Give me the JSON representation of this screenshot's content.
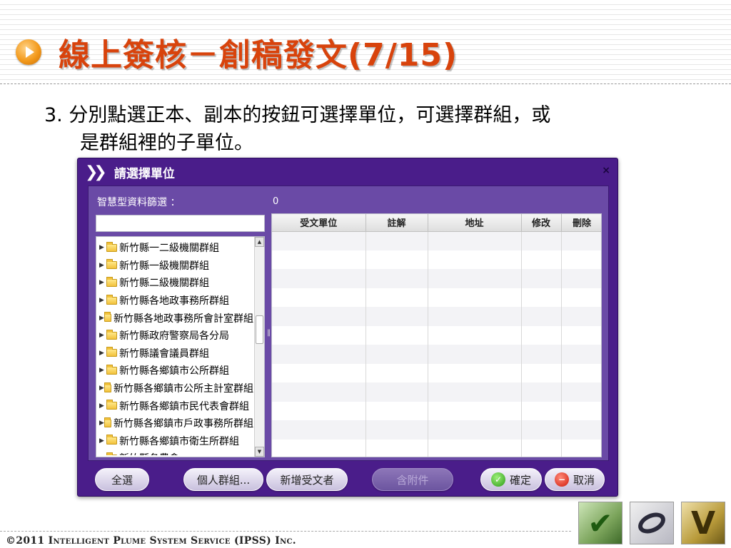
{
  "slide": {
    "title": "線上簽核－創稿發文(7/15)",
    "body_line1": "3. 分別點選正本、副本的按鈕可選擇單位，可選擇群組，或",
    "body_line2": "是群組裡的子單位。",
    "footer": "©2011 Intelligent Plume System Service (IPSS) Inc."
  },
  "dialog": {
    "title": "請選擇單位",
    "close_label": "×",
    "filter_label": "智慧型資料篩選 ：",
    "count": "0",
    "search_value": "",
    "tree_items": [
      "新竹縣一二級機關群組",
      "新竹縣一級機關群組",
      "新竹縣二級機關群組",
      "新竹縣各地政事務所群組",
      "新竹縣各地政事務所會計室群組",
      "新竹縣政府警察局各分局",
      "新竹縣議會議員群組",
      "新竹縣各鄉鎮市公所群組",
      "新竹縣各鄉鎮市公所主計室群組",
      "新竹縣各鄉鎮市民代表會群組",
      "新竹縣各鄉鎮市戶政事務所群組",
      "新竹縣各鄉鎮市衛生所群組",
      "新竹縣各農會"
    ],
    "columns": [
      "受文單位",
      "註解",
      "地址",
      "修改",
      "刪除"
    ],
    "buttons": {
      "select_all": "全選",
      "personal_group": "個人群組...",
      "add_recipient": "新增受文者",
      "with_attachment": "含附件",
      "confirm": "確定",
      "cancel": "取消"
    }
  },
  "colors": {
    "title": "#d8430c",
    "dialog_bg": "#4a1d8a",
    "panel_bg": "#6a4aa6"
  }
}
